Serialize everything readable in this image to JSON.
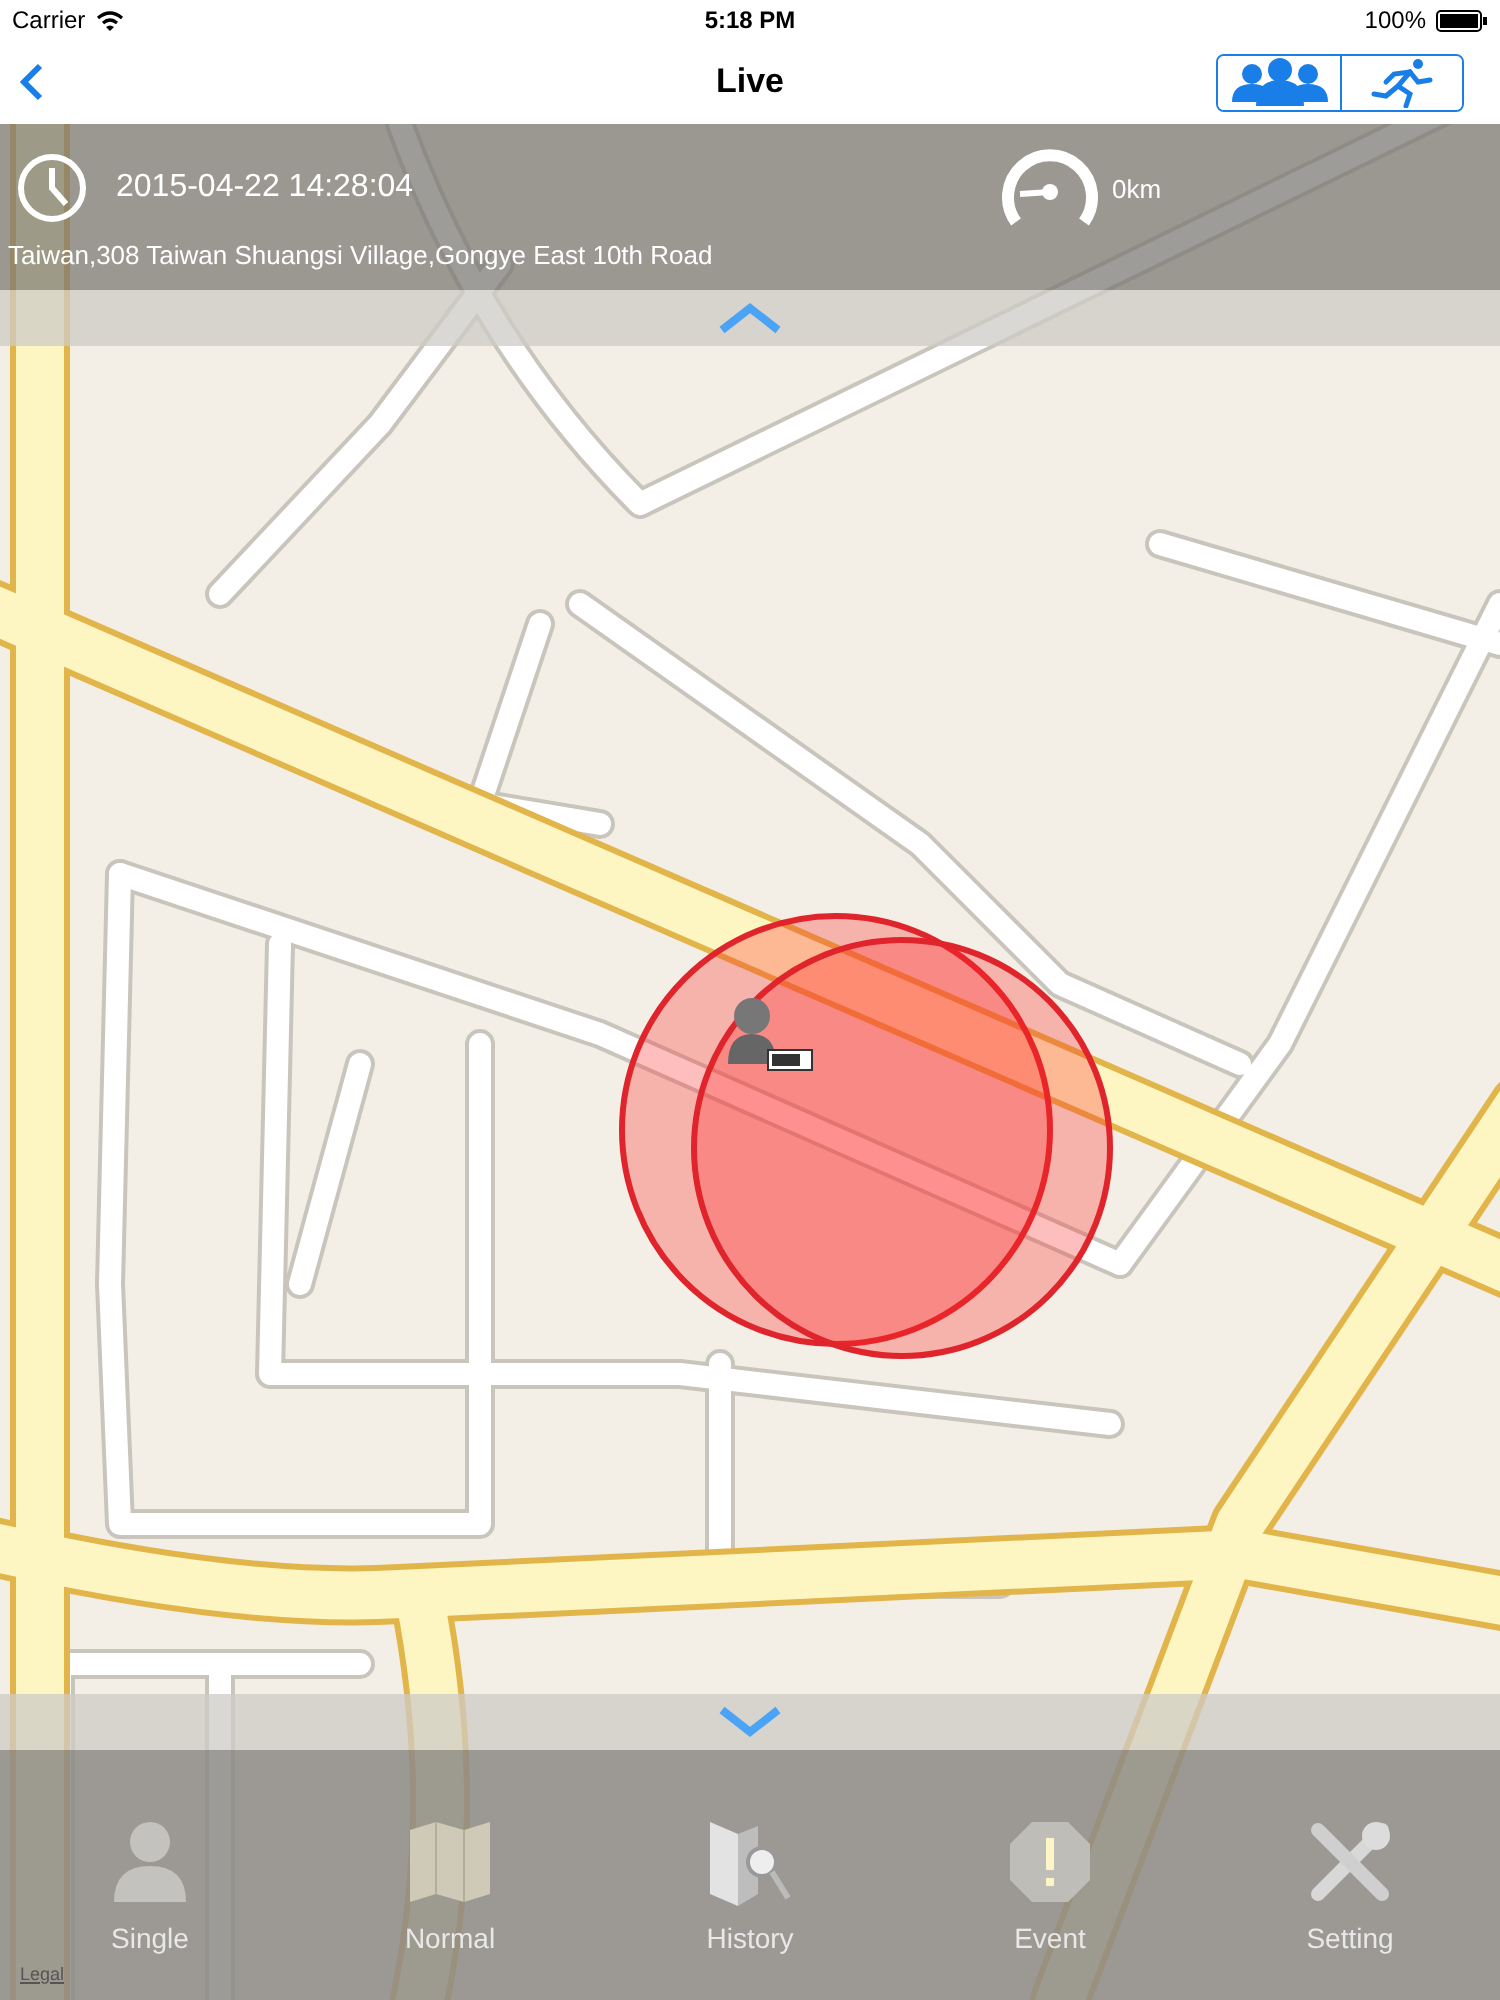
{
  "status_bar": {
    "carrier": "Carrier",
    "time": "5:18 PM",
    "battery": "100%"
  },
  "nav": {
    "title": "Live"
  },
  "info": {
    "datetime": "2015-04-22 14:28:04",
    "distance": "0km",
    "address": "Taiwan,308 Taiwan Shuangsi Village,Gongye East 10th Road"
  },
  "map": {
    "legal": "Legal"
  },
  "tabs": [
    {
      "label": "Single"
    },
    {
      "label": "Normal"
    },
    {
      "label": "History"
    },
    {
      "label": "Event"
    },
    {
      "label": "Setting"
    }
  ]
}
